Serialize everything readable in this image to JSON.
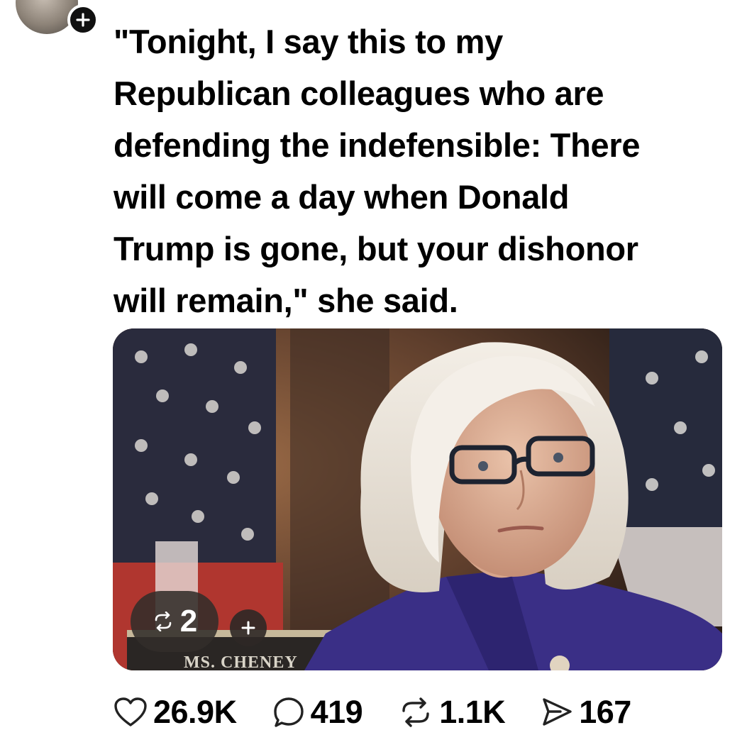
{
  "post": {
    "text": "\"Tonight, I say this to my\nRepublican colleagues who are\ndefending the indefensible: There\nwill come a day when Donald\nTrump is gone, but your dishonor\nwill remain,\" she said.",
    "nameplate": "MS. CHENEY",
    "media_repost_count": "2"
  },
  "actions": {
    "likes": "26.9K",
    "replies": "419",
    "reposts": "1.1K",
    "shares": "167"
  },
  "icons": [
    "plus-icon",
    "heart-icon",
    "comment-icon",
    "repost-icon",
    "share-icon"
  ]
}
